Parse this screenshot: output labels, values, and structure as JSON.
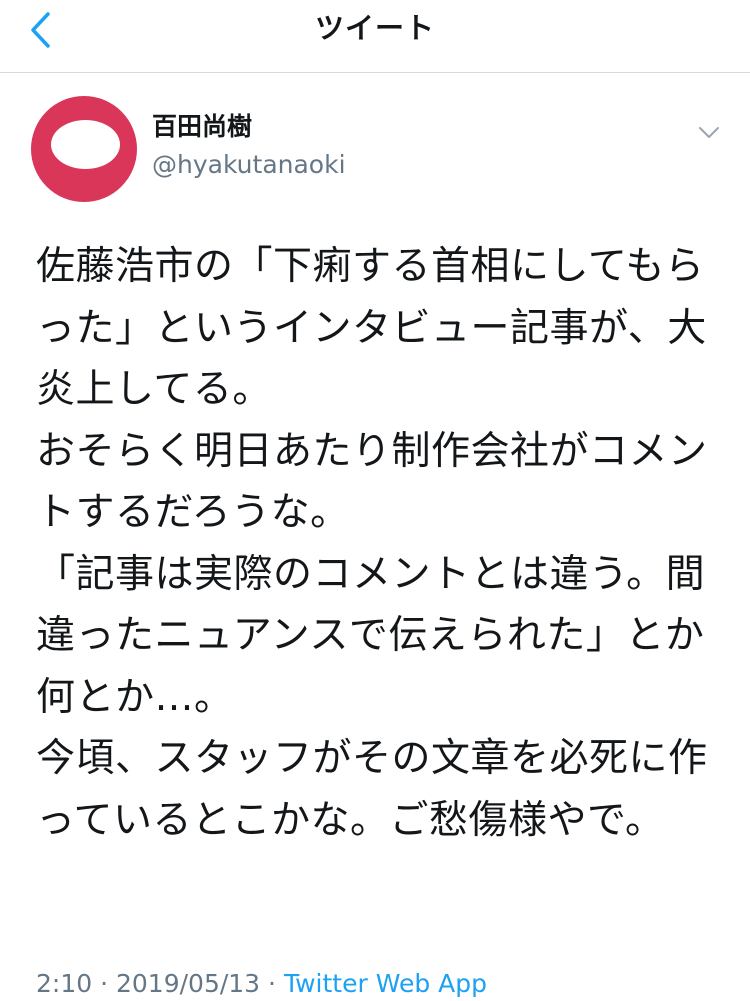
{
  "header": {
    "title": "ツイート",
    "back_icon": "chevron-left-icon",
    "accent_color": "#1da1f2"
  },
  "author": {
    "display_name": "百田尚樹",
    "handle": "@hyakutanaoki",
    "avatar_color": "#d9365a"
  },
  "tweet": {
    "text": "佐藤浩市の「下痢する首相にしてもらった」というインタビュー記事が、大炎上してる。\nおそらく明日あたり制作会社がコメントするだろうな。\n「記事は実際のコメントとは違う。間違ったニュアンスで伝えられた」とか何とか…。\n今頃、スタッフがその文章を必死に作っているとこかな。ご愁傷様やで。",
    "time": "2:10",
    "separator": "·",
    "date": "2019/05/13",
    "source": "Twitter Web App"
  },
  "menu_icon": "chevron-down-icon"
}
